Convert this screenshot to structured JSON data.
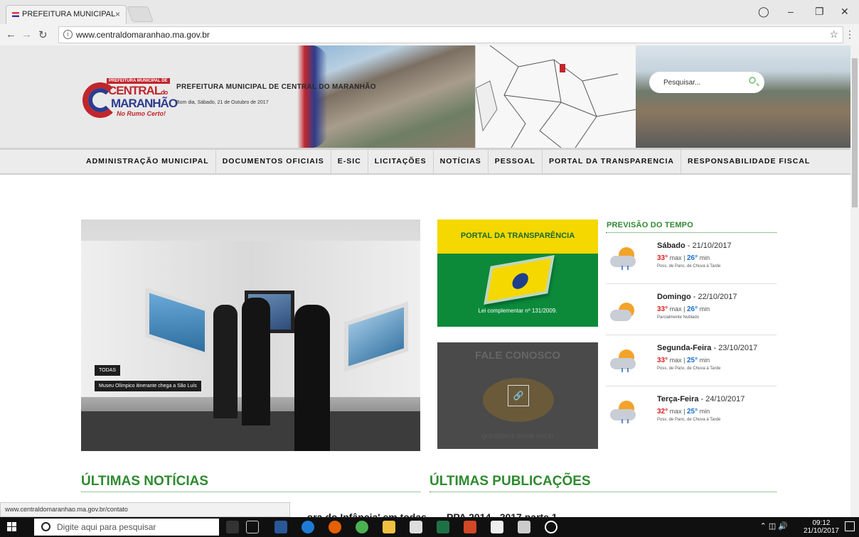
{
  "browser": {
    "tab_title": "PREFEITURA MUNICIPAL",
    "tab_close": "×",
    "url": "www.centraldomaranhao.ma.gov.br",
    "status_url": "www.centraldomaranhao.ma.gov.br/contato"
  },
  "header": {
    "logo_top": "PREFEITURA MUNICIPAL DE",
    "logo_line1": "CENTRAL",
    "logo_do": "do",
    "logo_line2": "MARANHÃO",
    "logo_slogan": "No Rumo Certo!",
    "title": "PREFEITURA MUNICIPAL DE CENTRAL DO MARANHÃO",
    "greeting": "Bom dia, Sábado, 21 de Outubro de 2017",
    "search_placeholder": "Pesquisar..."
  },
  "nav": [
    "ADMINISTRAÇÃO MUNICIPAL",
    "DOCUMENTOS OFICIAIS",
    "E-SIC",
    "LICITAÇÕES",
    "NOTÍCIAS",
    "PESSOAL",
    "PORTAL DA TRANSPARENCIA",
    "RESPONSABILIDADE FISCAL"
  ],
  "slider": {
    "tag": "TODAS",
    "caption": "Museu Olímpico itinerante chega a São Luís"
  },
  "portal": {
    "title": "PORTAL DA TRANSPARÊNCIA",
    "footer": "Lei complementar nº 131/2009."
  },
  "contact": {
    "title": "FALE CONOSCO",
    "subtitle": "QUEREMOS OUVIR VOCÊ!"
  },
  "weather": {
    "title": "PREVISÃO DO TEMPO",
    "days": [
      {
        "day": "Sábado",
        "date": "21/10/2017",
        "max": "33°",
        "min": "26°",
        "desc": "Poss. de Panc. de Chuva à Tarde"
      },
      {
        "day": "Domingo",
        "date": "22/10/2017",
        "max": "33°",
        "min": "26°",
        "desc": "Parcialmente Nublado"
      },
      {
        "day": "Segunda-Feira",
        "date": "23/10/2017",
        "max": "33°",
        "min": "25°",
        "desc": "Poss. de Panc. de Chuva à Tarde"
      },
      {
        "day": "Terça-Feira",
        "date": "24/10/2017",
        "max": "32°",
        "min": "25°",
        "desc": "Poss. de Panc. de Chuva à Tarde"
      }
    ],
    "max_label": "max",
    "min_label": "min"
  },
  "sections": {
    "news": "ÚLTIMAS NOTÍCIAS",
    "publications": "ÚLTIMAS PUBLICAÇÕES",
    "news_partial": "...ora do Infância' em todas",
    "pub_partial": "PPA 2014 - 2017 parte 1"
  },
  "taskbar": {
    "search": "Digite aqui para pesquisar",
    "time": "09:12",
    "date": "21/10/2017"
  }
}
